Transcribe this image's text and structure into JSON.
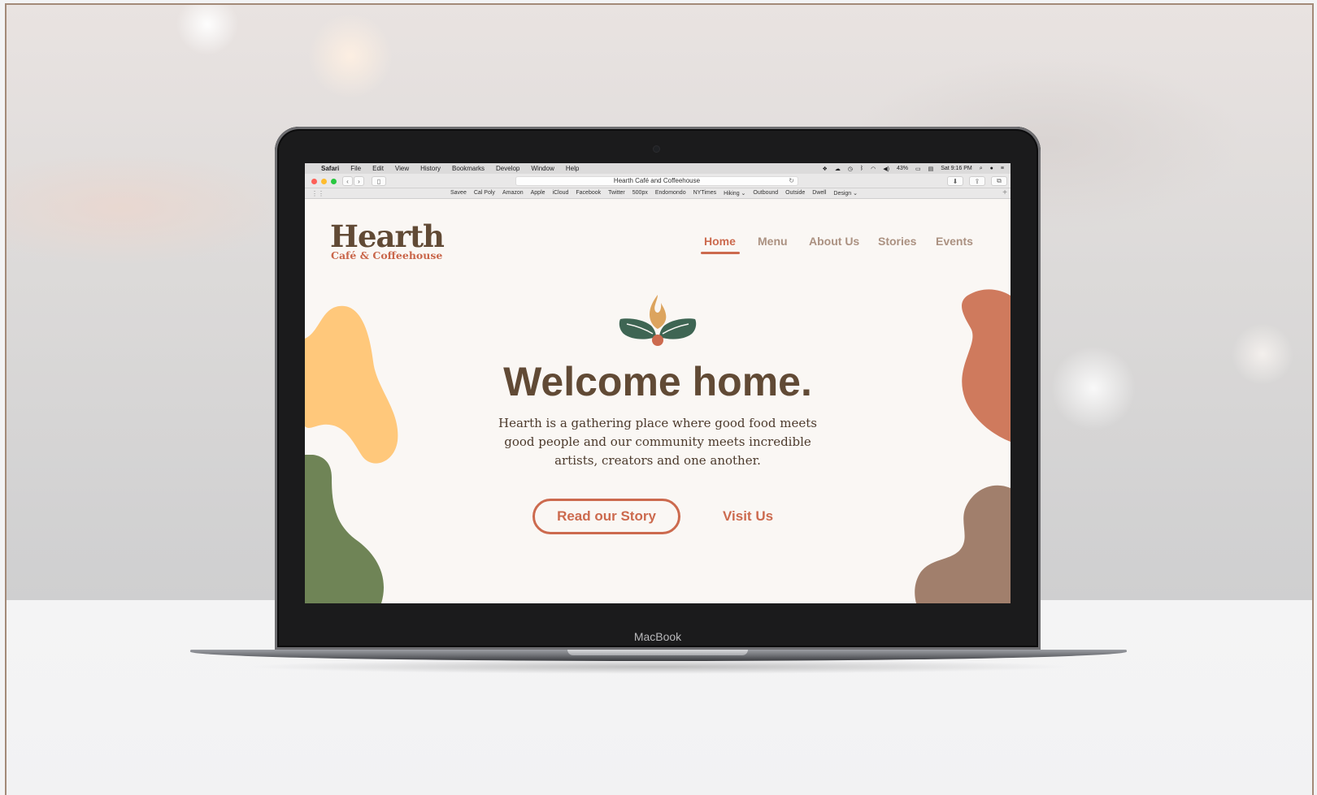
{
  "menubar": {
    "app": "Safari",
    "items": [
      "File",
      "Edit",
      "View",
      "History",
      "Bookmarks",
      "Develop",
      "Window",
      "Help"
    ],
    "battery": "43%",
    "clock": "Sat 9:16 PM"
  },
  "browser": {
    "url": "Hearth Café and Coffeehouse",
    "favorites": [
      "Savee",
      "Cal Poly",
      "Amazon",
      "Apple",
      "iCloud",
      "Facebook",
      "Twitter",
      "500px",
      "Endomondo",
      "NYTimes",
      "Hiking ⌄",
      "Outbound",
      "Outside",
      "Dwell",
      "Design ⌄"
    ]
  },
  "site": {
    "logo_title": "Hearth",
    "logo_subtitle": "Café & Coffeehouse",
    "nav": [
      "Home",
      "Menu",
      "About Us",
      "Stories",
      "Events"
    ],
    "active_nav": "Home",
    "hero_title": "Welcome home.",
    "hero_copy": "Hearth is a gathering place where good food meets good people and our community meets incredible artists, creators and one another.",
    "primary_cta": "Read our Story",
    "secondary_cta": "Visit Us"
  },
  "device": {
    "label": "MacBook"
  },
  "colors": {
    "brand_brown": "#614a35",
    "accent_terracotta": "#cc6a4e",
    "nav_muted": "#ab9181",
    "blob_yellow": "#ffc87b",
    "blob_green": "#6f8456",
    "blob_orange": "#cf7a5d",
    "blob_taupe": "#a17f6c",
    "leaf_green": "#3e6553",
    "flame_gold": "#dca45e"
  }
}
